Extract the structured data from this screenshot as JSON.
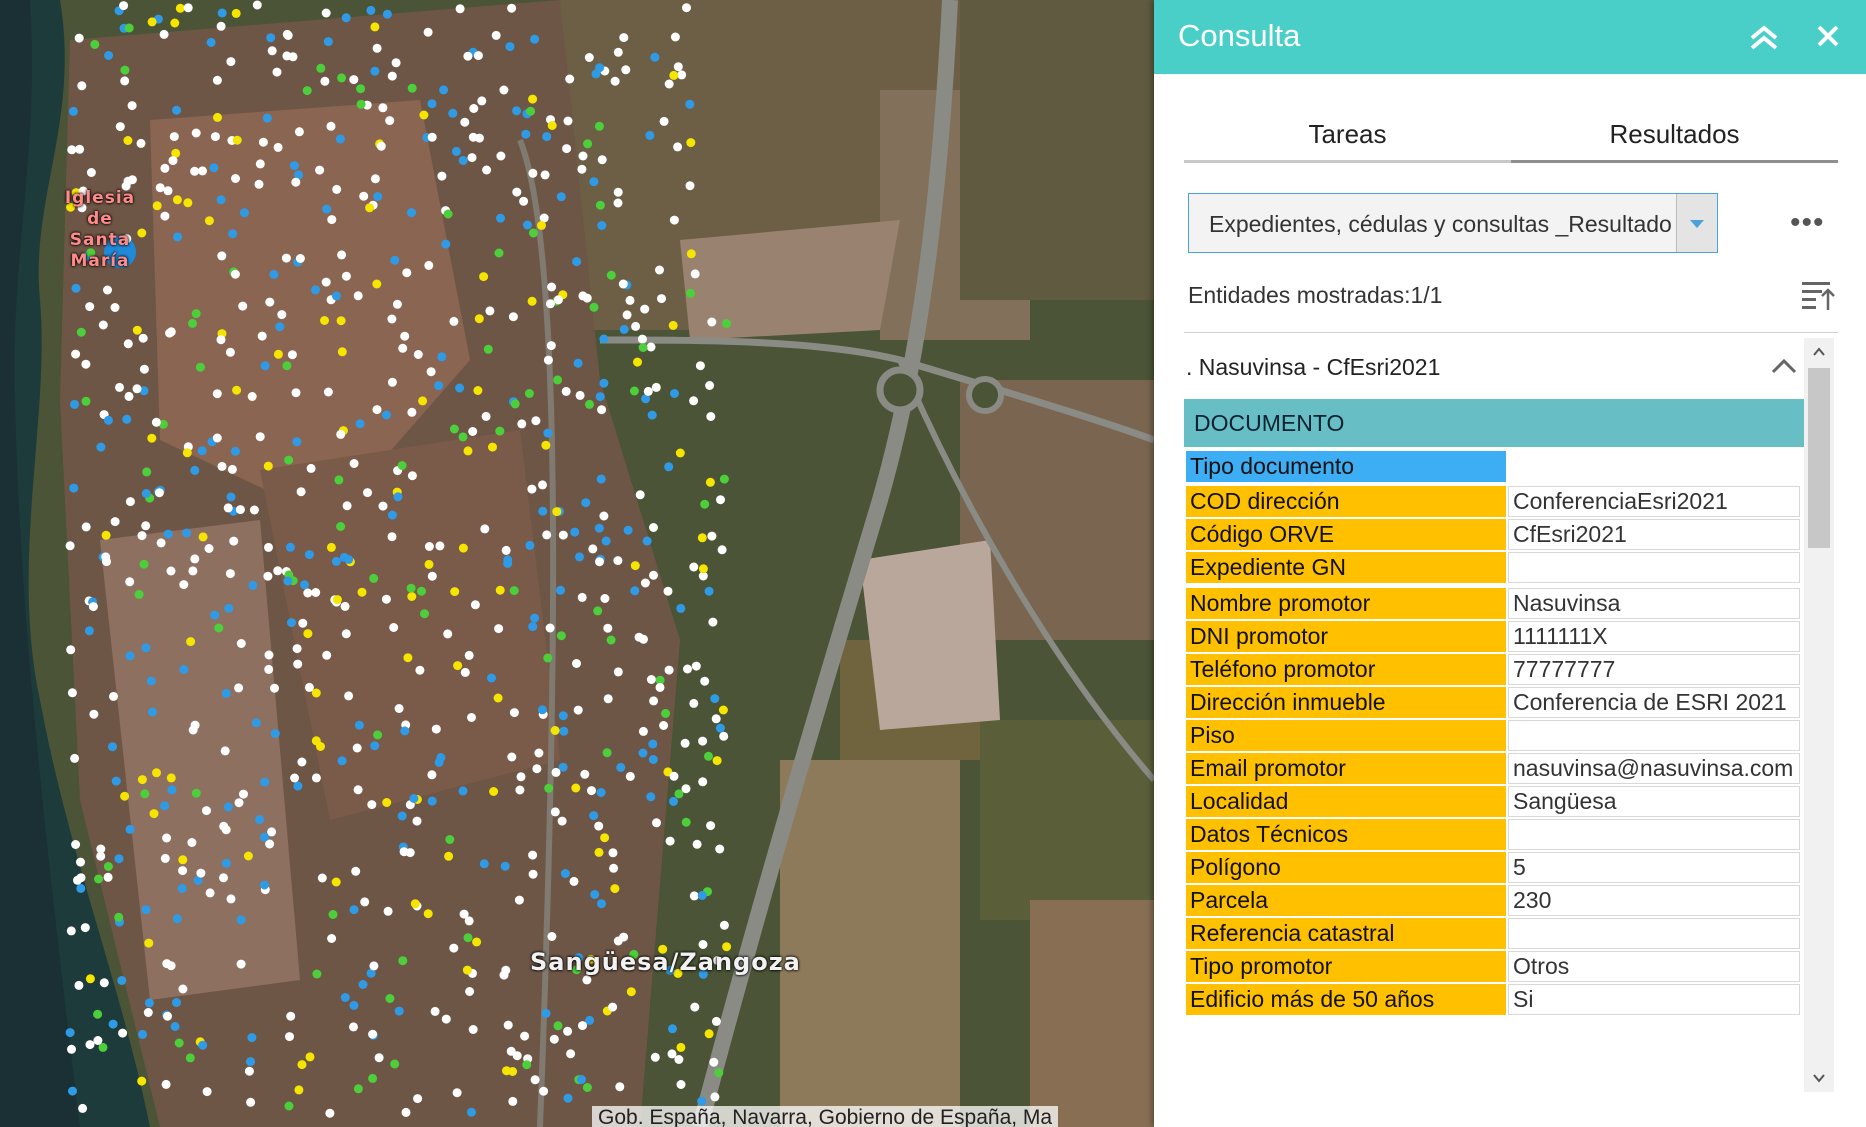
{
  "map": {
    "church_label": [
      "Iglesia de",
      "Santa",
      "María"
    ],
    "town_label": "Sangüesa/Zangoza",
    "attribution": "Gob. España, Navarra, Gobierno de España, Ma"
  },
  "panel": {
    "title": "Consulta",
    "tabs": [
      {
        "label": "Tareas",
        "active": false
      },
      {
        "label": "Resultados",
        "active": true
      }
    ],
    "layer_select": {
      "value": "Expedientes, cédulas y consultas _Resultado de"
    },
    "more_label": "•••",
    "count_text": "Entidades mostradas:1/1",
    "record": {
      "title": ". Nasuvinsa - CfEsri2021",
      "section": "DOCUMENTO",
      "fields": [
        {
          "label": "Tipo documento",
          "value": ""
        },
        {
          "label": "COD dirección",
          "value": "ConferenciaEsri2021"
        },
        {
          "label": "Código ORVE",
          "value": "CfEsri2021"
        },
        {
          "label": "Expediente GN",
          "value": ""
        },
        {
          "label": "Nombre promotor",
          "value": "Nasuvinsa"
        },
        {
          "label": "DNI promotor",
          "value": "1111111X"
        },
        {
          "label": "Teléfono promotor",
          "value": "77777777"
        },
        {
          "label": "Dirección inmueble",
          "value": "Conferencia de ESRI 2021"
        },
        {
          "label": "Piso",
          "value": ""
        },
        {
          "label": "Email promotor",
          "value": "nasuvinsa@nasuvinsa.com"
        },
        {
          "label": "Localidad",
          "value": "Sangüesa"
        },
        {
          "label": "Datos Técnicos",
          "value": ""
        },
        {
          "label": "Polígono",
          "value": "5"
        },
        {
          "label": "Parcela",
          "value": "230"
        },
        {
          "label": "Referencia catastral",
          "value": ""
        },
        {
          "label": "Tipo promotor",
          "value": "Otros"
        },
        {
          "label": "Edificio más de 50 años",
          "value": "Si"
        }
      ]
    }
  },
  "colors": {
    "header_bg": "#4acfc8",
    "section_bg": "#67bec4",
    "field_label_bg": "#ffc000",
    "selected_field_bg": "#3daef4"
  }
}
